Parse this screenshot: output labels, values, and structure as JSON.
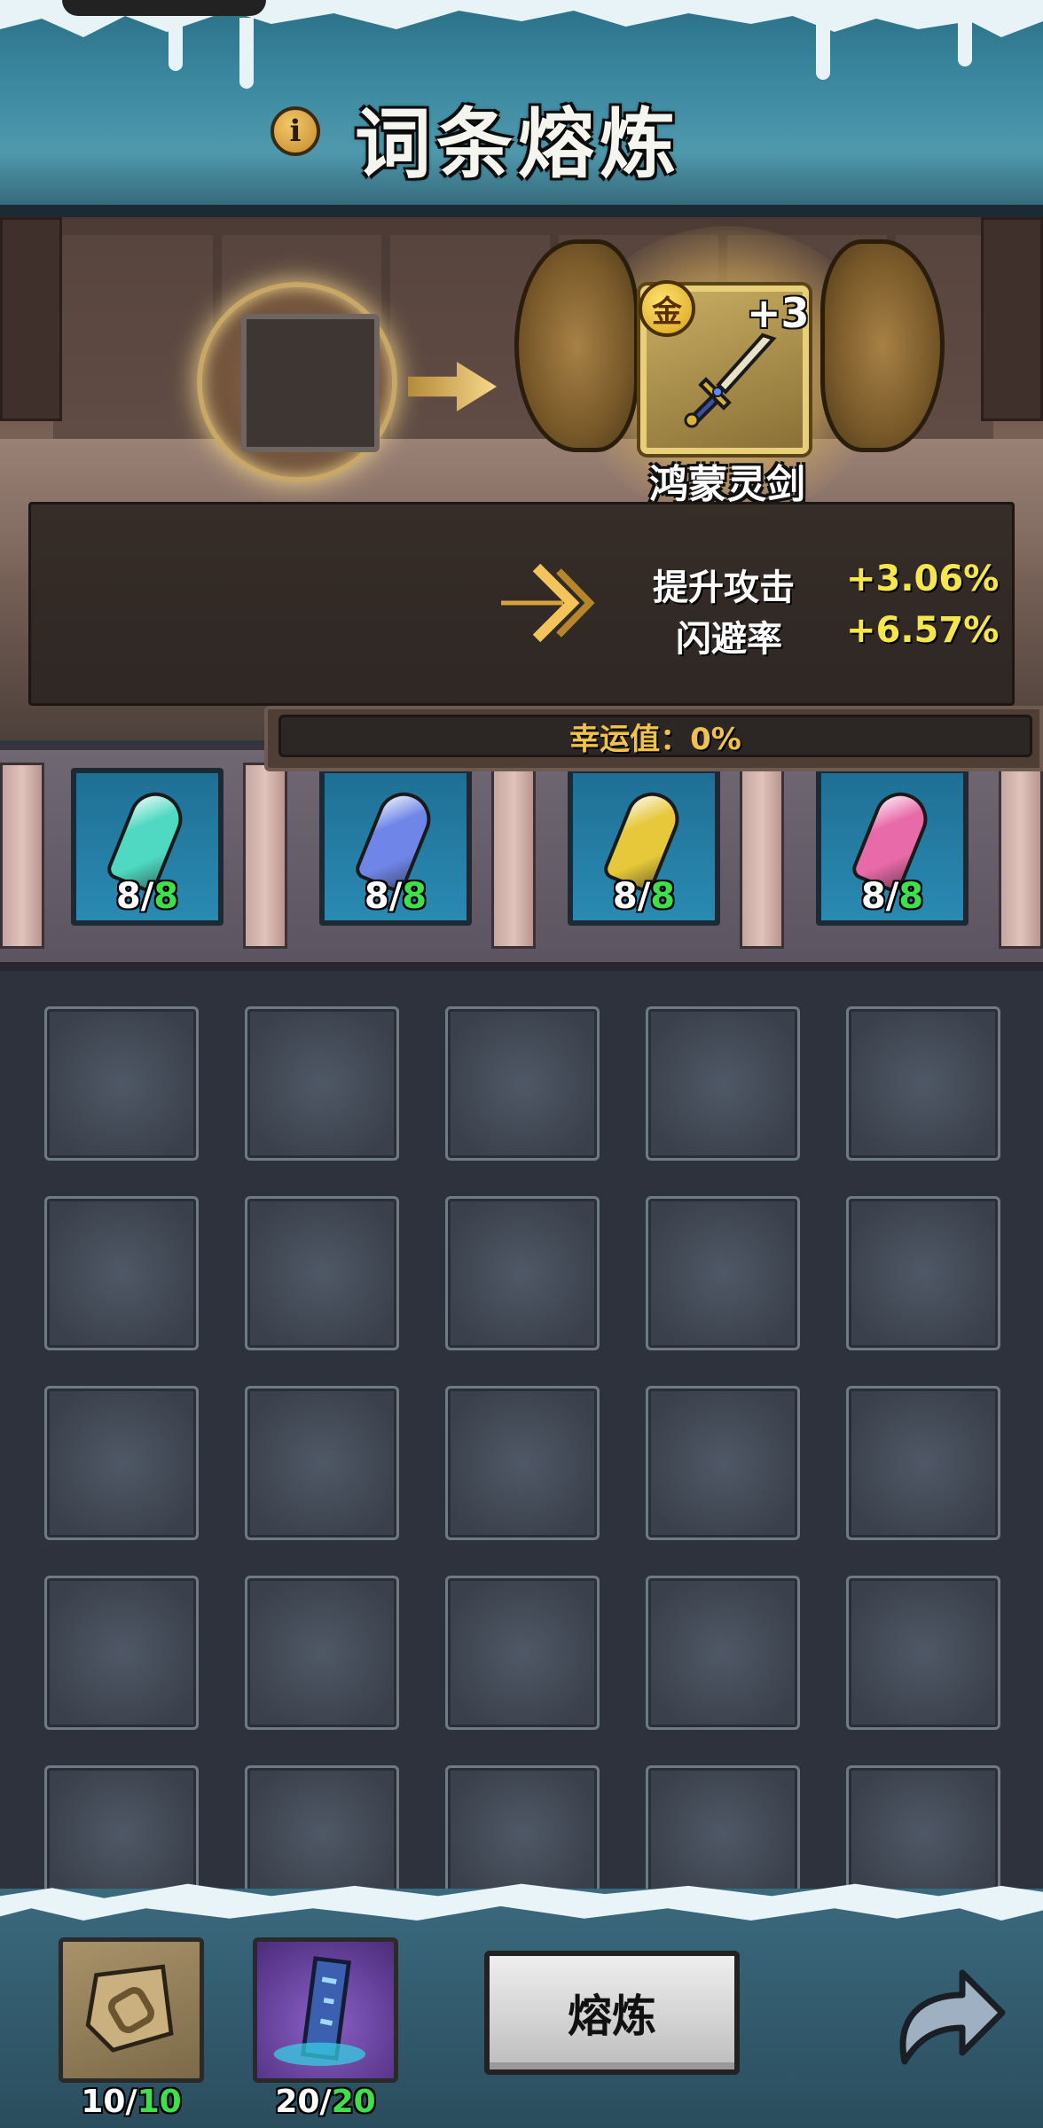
{
  "header": {
    "title": "词条熔炼",
    "info_icon": "info-icon"
  },
  "equipment": {
    "grade_badge": "金",
    "level": "+3",
    "name": "鸿蒙灵剑",
    "icon": "sword-icon"
  },
  "stats": [
    {
      "name": "提升攻击",
      "value": "+3.06%"
    },
    {
      "name": "闪避率",
      "value": "+6.57%"
    }
  ],
  "luck": {
    "label": "幸运值：0%"
  },
  "crystals": [
    {
      "name": "green-crystal",
      "have": "8",
      "need": "8",
      "color": "#4fd9c2"
    },
    {
      "name": "blue-crystal",
      "have": "8",
      "need": "8",
      "color": "#6f86e8"
    },
    {
      "name": "yellow-crystal",
      "have": "8",
      "need": "8",
      "color": "#e6c83a"
    },
    {
      "name": "pink-crystal",
      "have": "8",
      "need": "8",
      "color": "#e86aa8"
    }
  ],
  "inventory": {
    "rows": 5,
    "cols": 5
  },
  "materials": [
    {
      "name": "stone-tablet",
      "have": "10",
      "need": "10"
    },
    {
      "name": "rune-scroll",
      "have": "20",
      "need": "20"
    }
  ],
  "actions": {
    "smelt_label": "熔炼",
    "back_icon": "return-arrow-icon"
  },
  "colors": {
    "stat_value": "#f5e64c",
    "count_need": "#3fe04a",
    "luck_text": "#f1c24a"
  }
}
